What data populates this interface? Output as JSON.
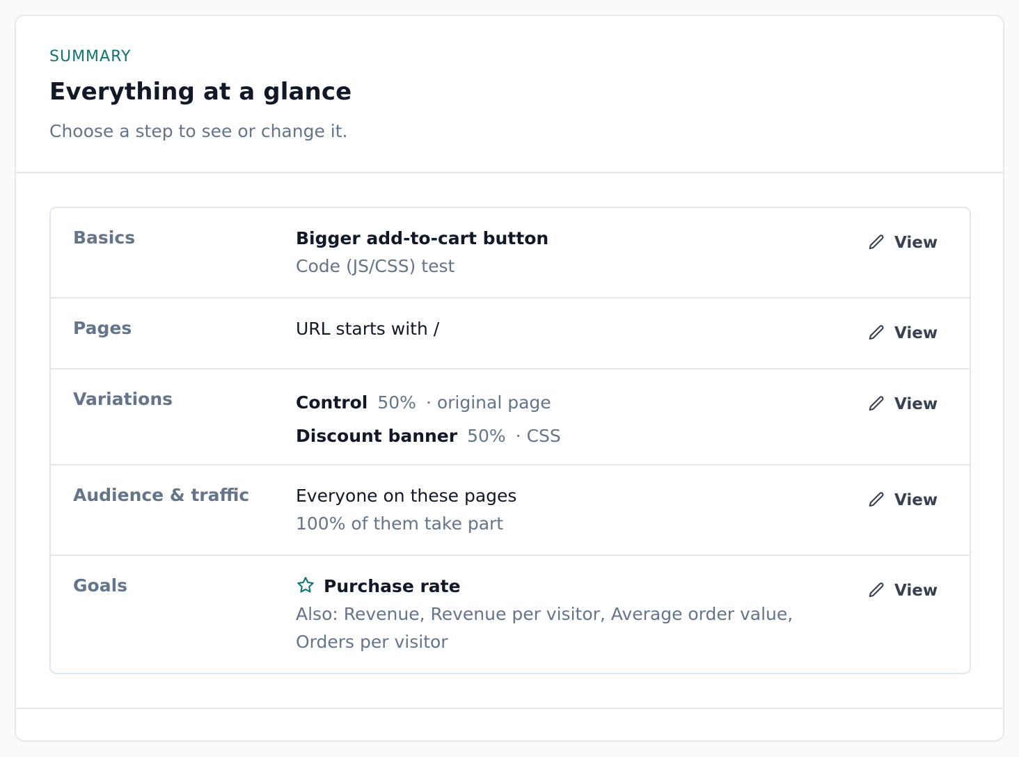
{
  "header": {
    "eyebrow": "SUMMARY",
    "title": "Everything at a glance",
    "subtitle": "Choose a step to see or change it."
  },
  "rows": [
    {
      "label": "Basics",
      "primary": "Bigger add-to-cart button",
      "secondary": "Code (JS/CSS) test",
      "action": "View"
    },
    {
      "label": "Pages",
      "primary": "URL starts with /",
      "action": "View"
    },
    {
      "label": "Variations",
      "variations": [
        {
          "name": "Control",
          "share": "50%",
          "detail": "· original page"
        },
        {
          "name": "Discount banner",
          "share": "50%",
          "detail": "· CSS"
        }
      ],
      "action": "View"
    },
    {
      "label": "Audience & traffic",
      "primary": "Everyone on these pages",
      "secondary": "100% of them take part",
      "action": "View"
    },
    {
      "label": "Goals",
      "primary": "Purchase rate",
      "secondary_line1": "Also: Revenue, Revenue per visitor, Average order value,",
      "secondary_line2": "Orders per visitor",
      "action": "View",
      "primary_icon": "star-icon"
    }
  ],
  "icons": {
    "action": "pencil-icon"
  },
  "colors": {
    "accent": "#0f766e",
    "text": "#111827",
    "muted": "#64748b",
    "border": "#e5e7eb"
  }
}
